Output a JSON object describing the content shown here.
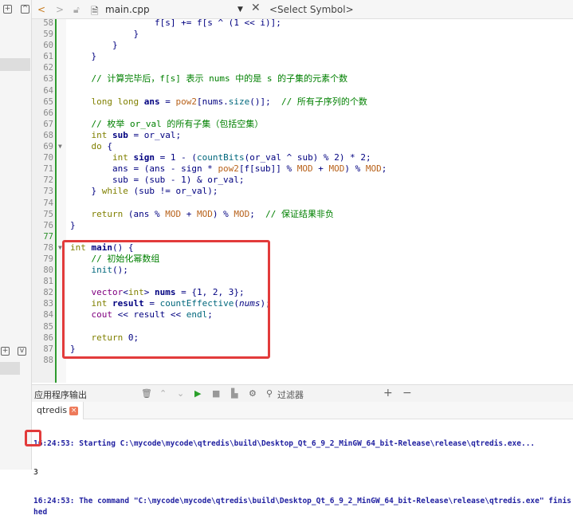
{
  "toolbar": {
    "file": "main.cpp",
    "symbol": "<Select Symbol>"
  },
  "editor": {
    "current_line": 77,
    "lines": [
      {
        "n": 58,
        "t": [
          [
            "                ",
            "p"
          ],
          [
            "f[s] += f[s ^ (",
            "p"
          ],
          [
            "1",
            "n"
          ],
          [
            " << i)];",
            "p"
          ]
        ]
      },
      {
        "n": 59,
        "t": [
          [
            "            }",
            "p"
          ]
        ]
      },
      {
        "n": 60,
        "t": [
          [
            "        }",
            "p"
          ]
        ]
      },
      {
        "n": 61,
        "t": [
          [
            "    }",
            "p"
          ]
        ]
      },
      {
        "n": 62,
        "t": []
      },
      {
        "n": 63,
        "t": [
          [
            "    // 计算完毕后，f[s] 表示 nums 中的是 s 的子集的元素个数",
            "c"
          ]
        ]
      },
      {
        "n": 64,
        "t": []
      },
      {
        "n": 65,
        "t": [
          [
            "    ",
            "p"
          ],
          [
            "long long",
            "k"
          ],
          [
            " ",
            "p"
          ],
          [
            "ans",
            "b"
          ],
          [
            " = ",
            "p"
          ],
          [
            "pow2",
            "m"
          ],
          [
            "[nums.",
            "p"
          ],
          [
            "size",
            "f"
          ],
          [
            "()];  ",
            "p"
          ],
          [
            "// 所有子序列的个数",
            "c"
          ]
        ]
      },
      {
        "n": 66,
        "t": []
      },
      {
        "n": 67,
        "t": [
          [
            "    // 枚举 or_val 的所有子集（包括空集）",
            "c"
          ]
        ]
      },
      {
        "n": 68,
        "t": [
          [
            "    ",
            "p"
          ],
          [
            "int",
            "k"
          ],
          [
            " ",
            "p"
          ],
          [
            "sub",
            "b"
          ],
          [
            " = or_val;",
            "p"
          ]
        ]
      },
      {
        "n": 69,
        "fold": true,
        "t": [
          [
            "    ",
            "p"
          ],
          [
            "do",
            "k"
          ],
          [
            " {",
            "p"
          ]
        ]
      },
      {
        "n": 70,
        "t": [
          [
            "        ",
            "p"
          ],
          [
            "int",
            "k"
          ],
          [
            " ",
            "p"
          ],
          [
            "sign",
            "b"
          ],
          [
            " = ",
            "p"
          ],
          [
            "1",
            "n"
          ],
          [
            " - (",
            "p"
          ],
          [
            "countBits",
            "f"
          ],
          [
            "(or_val ^ sub) % ",
            "p"
          ],
          [
            "2",
            "n"
          ],
          [
            ") * ",
            "p"
          ],
          [
            "2",
            "n"
          ],
          [
            ";",
            "p"
          ]
        ]
      },
      {
        "n": 71,
        "t": [
          [
            "        ans = (ans - sign * ",
            "p"
          ],
          [
            "pow2",
            "m"
          ],
          [
            "[f[sub]] % ",
            "p"
          ],
          [
            "MOD",
            "m"
          ],
          [
            " + ",
            "p"
          ],
          [
            "MOD",
            "m"
          ],
          [
            ") % ",
            "p"
          ],
          [
            "MOD",
            "m"
          ],
          [
            ";",
            "p"
          ]
        ]
      },
      {
        "n": 72,
        "t": [
          [
            "        sub = (sub - ",
            "p"
          ],
          [
            "1",
            "n"
          ],
          [
            ") & or_val;",
            "p"
          ]
        ]
      },
      {
        "n": 73,
        "t": [
          [
            "    } ",
            "p"
          ],
          [
            "while",
            "k"
          ],
          [
            " (sub != or_val);",
            "p"
          ]
        ]
      },
      {
        "n": 74,
        "t": []
      },
      {
        "n": 75,
        "t": [
          [
            "    ",
            "p"
          ],
          [
            "return",
            "k"
          ],
          [
            " (ans % ",
            "p"
          ],
          [
            "MOD",
            "m"
          ],
          [
            " + ",
            "p"
          ],
          [
            "MOD",
            "m"
          ],
          [
            ") % ",
            "p"
          ],
          [
            "MOD",
            "m"
          ],
          [
            ";  ",
            "p"
          ],
          [
            "// 保证结果非负",
            "c"
          ]
        ]
      },
      {
        "n": 76,
        "t": [
          [
            "}",
            "p"
          ]
        ]
      },
      {
        "n": 77,
        "t": []
      },
      {
        "n": 78,
        "fold": true,
        "t": [
          [
            "int",
            "k"
          ],
          [
            " ",
            "p"
          ],
          [
            "main",
            "b"
          ],
          [
            "() {",
            "p"
          ]
        ]
      },
      {
        "n": 79,
        "t": [
          [
            "    // 初始化幂数组",
            "c"
          ]
        ]
      },
      {
        "n": 80,
        "t": [
          [
            "    ",
            "p"
          ],
          [
            "init",
            "f"
          ],
          [
            "();",
            "p"
          ]
        ]
      },
      {
        "n": 81,
        "t": []
      },
      {
        "n": 82,
        "t": [
          [
            "    ",
            "p"
          ],
          [
            "vector",
            "t"
          ],
          [
            "<",
            "p"
          ],
          [
            "int",
            "k"
          ],
          [
            "> ",
            "p"
          ],
          [
            "nums",
            "b"
          ],
          [
            " = {",
            "p"
          ],
          [
            "1",
            "n"
          ],
          [
            ", ",
            "p"
          ],
          [
            "2",
            "n"
          ],
          [
            ", ",
            "p"
          ],
          [
            "3",
            "n"
          ],
          [
            "};",
            "p"
          ]
        ]
      },
      {
        "n": 83,
        "t": [
          [
            "    ",
            "p"
          ],
          [
            "int",
            "k"
          ],
          [
            " ",
            "p"
          ],
          [
            "result",
            "b"
          ],
          [
            " = ",
            "p"
          ],
          [
            "countEffective",
            "f"
          ],
          [
            "(",
            "p"
          ],
          [
            "nums",
            "i"
          ],
          [
            ");",
            "p"
          ]
        ]
      },
      {
        "n": 84,
        "t": [
          [
            "    ",
            "p"
          ],
          [
            "cout",
            "t"
          ],
          [
            " << result << ",
            "p"
          ],
          [
            "endl",
            "f"
          ],
          [
            ";",
            "p"
          ]
        ]
      },
      {
        "n": 85,
        "t": []
      },
      {
        "n": 86,
        "t": [
          [
            "    ",
            "p"
          ],
          [
            "return",
            "k"
          ],
          [
            " ",
            "p"
          ],
          [
            "0",
            "n"
          ],
          [
            ";",
            "p"
          ]
        ]
      },
      {
        "n": 87,
        "t": [
          [
            "}",
            "p"
          ]
        ]
      },
      {
        "n": 88,
        "t": []
      }
    ]
  },
  "output": {
    "title": "应用程序输出",
    "filter": "过滤器",
    "tab": "qtredis",
    "lines": [
      "16:24:53: Starting C:\\mycode\\mycode\\qtredis\\build\\Desktop_Qt_6_9_2_MinGW_64_bit-Release\\release\\qtredis.exe...",
      "3",
      "16:24:53: The command \"C:\\mycode\\mycode\\qtredis\\build\\Desktop_Qt_6_9_2_MinGW_64_bit-Release\\release\\qtredis.exe\" finished"
    ]
  }
}
